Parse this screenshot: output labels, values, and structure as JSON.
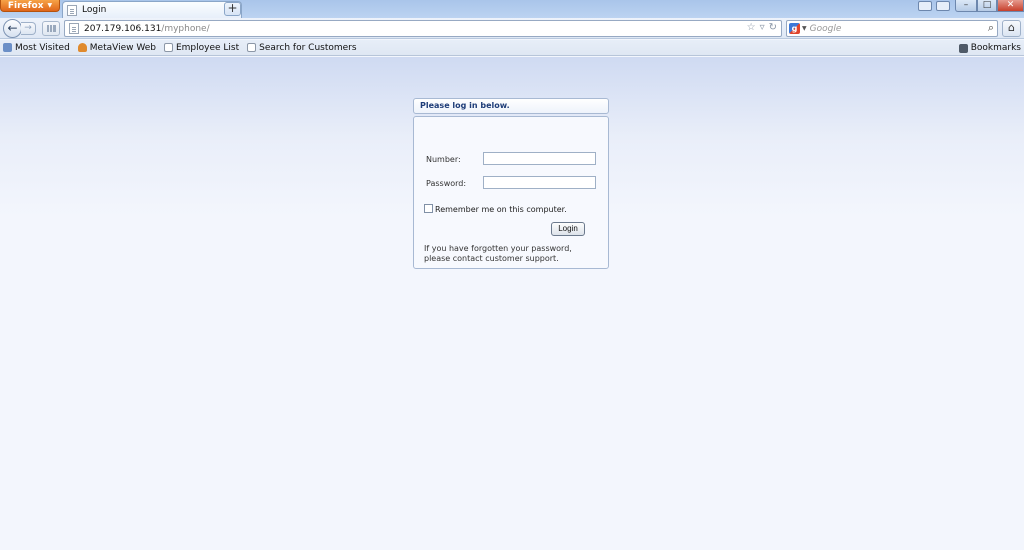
{
  "browser": {
    "menu_button": "Firefox",
    "tab_title": "Login",
    "newtab_label": "+",
    "url_host": "207.179.106.131",
    "url_path": "/myphone/",
    "search_placeholder": "Google",
    "bookmarks": [
      {
        "label": "Most Visited",
        "icon": "most-visited-icon"
      },
      {
        "label": "MetaView Web",
        "icon": "metaview-icon"
      },
      {
        "label": "Employee List",
        "icon": "page-icon"
      },
      {
        "label": "Search for Customers",
        "icon": "page-icon"
      }
    ],
    "bookmarks_menu": "Bookmarks",
    "window_controls": {
      "minimize": "–",
      "maximize": "□",
      "close": "✕"
    }
  },
  "login": {
    "header": "Please log in below.",
    "number_label": "Number:",
    "number_value": "",
    "password_label": "Password:",
    "password_value": "",
    "remember_label": "Remember me on this computer.",
    "remember_checked": false,
    "submit_label": "Login",
    "help_text": "If you have forgotten your password, please contact customer support."
  },
  "colors": {
    "header_text": "#1e3d78",
    "page_background": "#f3f6fd",
    "firefox_button": "#e0661a"
  }
}
